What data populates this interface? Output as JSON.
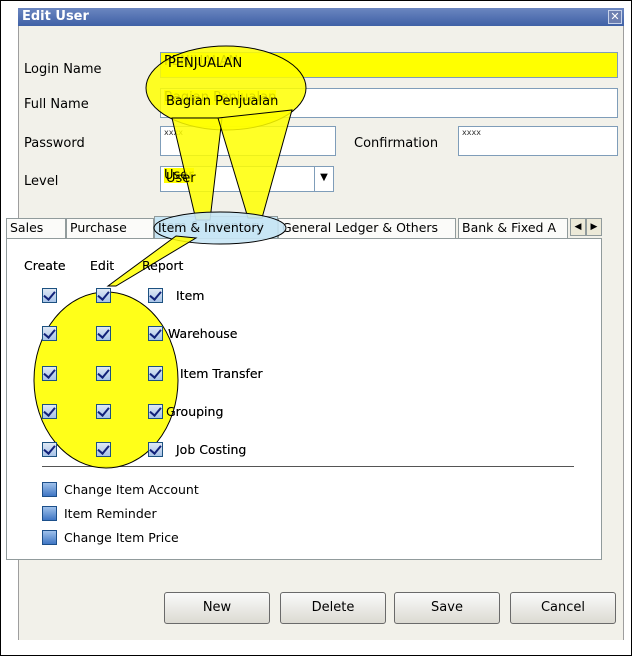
{
  "window": {
    "title": "Edit User",
    "close_glyph": "✕"
  },
  "form": {
    "login_name_label": "Login Name",
    "login_name_value": "PENJUALAN",
    "full_name_label": "Full Name",
    "full_name_value": "Bagian Penjualan",
    "password_label": "Password",
    "password_value": "xxxx",
    "confirmation_label": "Confirmation",
    "confirmation_value": "xxxx",
    "level_label": "Level",
    "level_value": "User"
  },
  "tabs": [
    {
      "label": "Sales"
    },
    {
      "label": "Purchase"
    },
    {
      "label": "Item & Inventory"
    },
    {
      "label": "General Ledger & Others"
    },
    {
      "label": "Bank & Fixed A"
    }
  ],
  "active_tab": "Item & Inventory",
  "columns": [
    "Create",
    "Edit",
    "Report"
  ],
  "permissions": [
    {
      "label": "Item",
      "create": true,
      "edit": true,
      "report": true
    },
    {
      "label": "Warehouse",
      "create": true,
      "edit": true,
      "report": true
    },
    {
      "label": "Item Transfer",
      "create": true,
      "edit": true,
      "report": true
    },
    {
      "label": "Grouping",
      "create": true,
      "edit": true,
      "report": true
    },
    {
      "label": "Job Costing",
      "create": true,
      "edit": true,
      "report": true
    }
  ],
  "extras": [
    {
      "label": "Change Item Account",
      "checked": false
    },
    {
      "label": "Item Reminder",
      "checked": false
    },
    {
      "label": "Change Item Price",
      "checked": false
    }
  ],
  "buttons": {
    "new": "New",
    "delete": "Delete",
    "save": "Save",
    "cancel": "Cancel"
  },
  "colors": {
    "highlight": "#ffff00",
    "titlebar": "#3f61a6"
  }
}
